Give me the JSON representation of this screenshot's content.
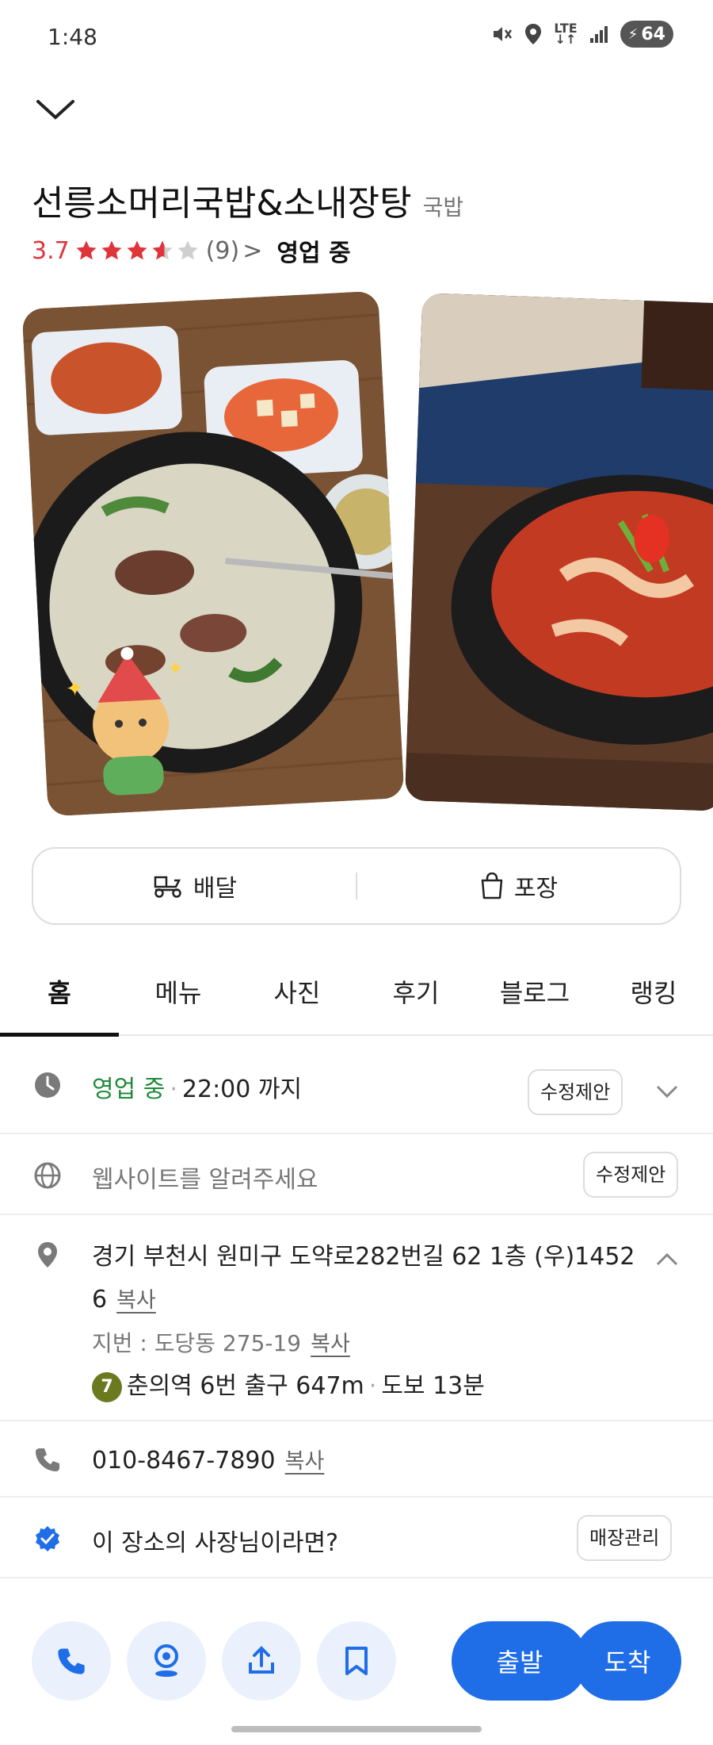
{
  "status_bar": {
    "time": "1:48",
    "network": "LTE",
    "battery": "64",
    "icons": [
      "mute-icon",
      "location-icon",
      "lte-icon",
      "signal-icon",
      "battery-icon"
    ]
  },
  "place": {
    "name": "선릉소머리국밥&소내장탕",
    "category": "국밥",
    "rating": "3.7",
    "stars": 3.7,
    "review_count": "(9)",
    "review_chevron": ">",
    "status": "영업 중"
  },
  "order": {
    "delivery_label": "배달",
    "takeout_label": "포장"
  },
  "tabs": [
    {
      "label": "홈",
      "active": true
    },
    {
      "label": "메뉴",
      "active": false
    },
    {
      "label": "사진",
      "active": false
    },
    {
      "label": "후기",
      "active": false
    },
    {
      "label": "블로그",
      "active": false
    },
    {
      "label": "랭킹",
      "active": false
    }
  ],
  "hours": {
    "status": "영업 중",
    "until": "22:00 까지",
    "suggest_label": "수정제안"
  },
  "website": {
    "text": "웹사이트를 알려주세요",
    "suggest_label": "수정제안"
  },
  "address": {
    "line1": "경기 부천시 원미구 도약로282번길 62 1층 (우)1452",
    "line2": "6",
    "copy_label": "복사",
    "lot_label": "지번 : 도당동 275-19",
    "lot_copy_label": "복사",
    "subway_line": "7",
    "subway_text": "춘의역 6번 출구 647m",
    "walk_text": "도보 13분"
  },
  "phone": {
    "number": "010-8467-7890",
    "copy_label": "복사"
  },
  "owner": {
    "text": "이 장소의 사장님이라면?",
    "manage_label": "매장관리"
  },
  "bottom_bar": {
    "depart_label": "출발",
    "arrive_label": "도착"
  },
  "colors": {
    "accent_blue": "#1f6ee8",
    "rating_red": "#e0343b",
    "open_green": "#1f8a3a",
    "subway_line7": "#6b7a1f"
  }
}
